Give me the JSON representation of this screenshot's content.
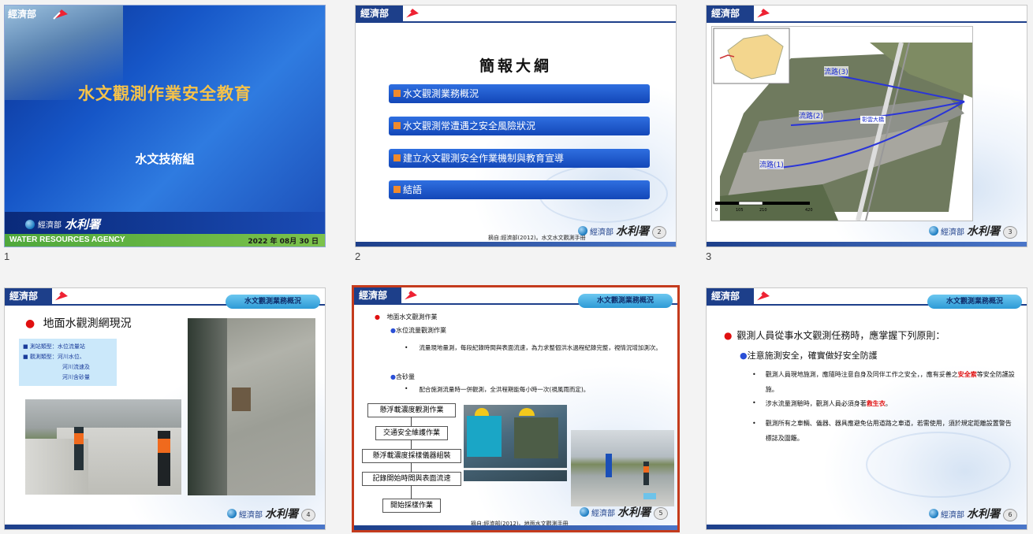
{
  "slides": [
    {
      "number": "1",
      "title": "水文觀測作業安全教育",
      "subtitle": "水文技術組",
      "agency_cn": "經濟部",
      "agency_logo": "水利署",
      "agency_en": "WATER RESOURCES AGENCY",
      "date": "2022 年 08月 30 日",
      "brand": "經濟部"
    },
    {
      "number": "2",
      "brand": "經濟部",
      "title": "簡報大綱",
      "items": [
        "水文觀測業務概況",
        "水文觀測常遭遇之安全風險狀況",
        "建立水文觀測安全作業機制與教育宣導",
        "結語"
      ],
      "citation": "摘自:經濟部(2012)。水文水文觀測手冊",
      "footer_small": "經濟部",
      "footer_big": "水利署",
      "page": "2"
    },
    {
      "number": "3",
      "brand": "經濟部",
      "map_labels": [
        "流路(3)",
        "流路(2)",
        "彰雲大橋",
        "流路(1)"
      ],
      "scale_labels": [
        "0",
        "105",
        "210",
        "420"
      ],
      "footer_small": "經濟部",
      "footer_big": "水利署",
      "page": "3"
    },
    {
      "number": "4",
      "brand": "經濟部",
      "tag": "水文觀測業務概況",
      "heading": "地面水觀測網現況",
      "info": [
        "測站類型：水位流量站",
        "觀測類型：河川水位、",
        "河川流速及",
        "河川含砂量"
      ],
      "footer_small": "經濟部",
      "footer_big": "水利署",
      "page": "4"
    },
    {
      "number": "5",
      "brand": "經濟部",
      "tag": "水文觀測業務概況",
      "l1": "地面水文觀測作業",
      "l2a": "水位流量觀測作業",
      "l3a": "流量現地量測，每段紀錄時間與表面流速，為力求整個洪水過程紀錄完整，視情況增加測次。",
      "l2b": "含砂量",
      "l3b": "配合施測流量時一併觀測，全洪程期能每小時一次(視風雨而定)。",
      "flow": [
        "懸浮載濃度觀測作業",
        "交通安全維護作業",
        "懸浮載濃度採樣儀器組裝",
        "記錄開始時間與表面流速",
        "開始採樣作業"
      ],
      "citation": "摘自:經濟部(2012)。地面水文觀測手冊",
      "footer_small": "經濟部",
      "footer_big": "水利署",
      "page": "5"
    },
    {
      "number": "6",
      "brand": "經濟部",
      "tag": "水文觀測業務概況",
      "heading": "觀測人員從事水文觀測任務時，應掌握下列原則：",
      "sub": "注意施測安全，確實做好安全防護",
      "b1_pre": "觀測人員現地施測，應隨時注意自身及同伴工作之安全，，應有妥善之",
      "b1_red": "安全索",
      "b1_post": "等安全防護設施。",
      "b2_pre": "涉水流量測驗時，觀測人員必須身著",
      "b2_red": "救生衣",
      "b2_post": "。",
      "b3": "觀測所有之車輛、儀器、器具應避免佔用道路之車道，若需使用，須於規定距離設置警告標誌及圍籬。",
      "footer_small": "經濟部",
      "footer_big": "水利署",
      "page": "6"
    }
  ],
  "colors": {
    "navy": "#1d3f8a",
    "selected": "#c43b1d",
    "title_gold": "#f5c24a",
    "red": "#e01010"
  }
}
